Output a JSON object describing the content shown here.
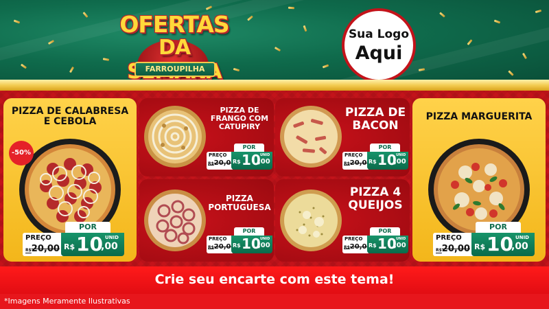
{
  "header": {
    "title_line1": "OFERTAS",
    "title_line2": "DA SEMANA",
    "ribbon": "FARROUPILHA",
    "logo_line1": "Sua Logo",
    "logo_line2": "Aqui"
  },
  "colors": {
    "green": "#0f6b4c",
    "red": "#c3131a",
    "yellow": "#f3b61a",
    "gold": "#f2c94c"
  },
  "products": [
    {
      "title_lines": [
        "PIZZA DE CALABRESA",
        "E CEBOLA"
      ],
      "discount": "-50%",
      "preco_label": "PREÇO",
      "old_currency": "R$",
      "old_price": "20,00",
      "por_label": "POR",
      "currency": "R$",
      "price_int": "10",
      "price_dec": ",00",
      "unid": "UNID"
    },
    {
      "title_lines": [
        "PIZZA DE",
        "FRANGO COM",
        "CATUPIRY"
      ],
      "preco_label": "PREÇO",
      "old_currency": "R$",
      "old_price": "20,00",
      "por_label": "POR",
      "currency": "R$",
      "price_int": "10",
      "price_dec": ",00",
      "unid": "UNID"
    },
    {
      "title_lines": [
        "PIZZA DE",
        "BACON"
      ],
      "preco_label": "PREÇO",
      "old_currency": "R$",
      "old_price": "20,00",
      "por_label": "POR",
      "currency": "R$",
      "price_int": "10",
      "price_dec": ",00",
      "unid": "UNID"
    },
    {
      "title_lines": [
        "PIZZA MARGUERITA"
      ],
      "preco_label": "PREÇO",
      "old_currency": "R$",
      "old_price": "20,00",
      "por_label": "POR",
      "currency": "R$",
      "price_int": "10",
      "price_dec": ",00",
      "unid": "UNID"
    },
    {
      "title_lines": [
        "PIZZA",
        "PORTUGUESA"
      ],
      "preco_label": "PREÇO",
      "old_currency": "R$",
      "old_price": "20,00",
      "por_label": "POR",
      "currency": "R$",
      "price_int": "10",
      "price_dec": ",00",
      "unid": "UNID"
    },
    {
      "title_lines": [
        "PIZZA 4",
        "QUEIJOS"
      ],
      "preco_label": "PREÇO",
      "old_currency": "R$",
      "old_price": "20,00",
      "por_label": "POR",
      "currency": "R$",
      "price_int": "10",
      "price_dec": ",00",
      "unid": "UNID"
    }
  ],
  "banner": "Crie seu encarte com este tema!",
  "footnote": "*Imagens Meramente Ilustrativas"
}
